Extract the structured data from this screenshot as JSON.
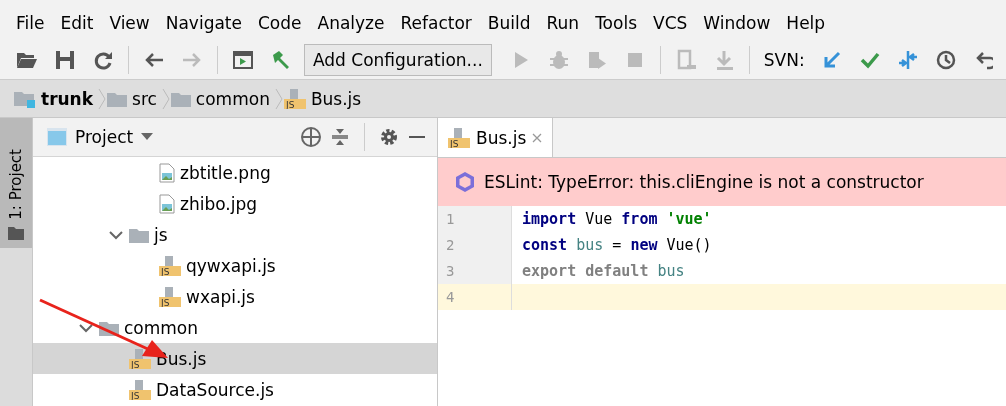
{
  "menu": [
    "File",
    "Edit",
    "View",
    "Navigate",
    "Code",
    "Analyze",
    "Refactor",
    "Build",
    "Run",
    "Tools",
    "VCS",
    "Window",
    "Help"
  ],
  "toolbar": {
    "config_button": "Add Configuration...",
    "svn_label": "SVN:"
  },
  "breadcrumbs": [
    {
      "label": "trunk",
      "kind": "module"
    },
    {
      "label": "src",
      "kind": "folder"
    },
    {
      "label": "common",
      "kind": "folder"
    },
    {
      "label": "Bus.js",
      "kind": "js",
      "icon_label": "JS"
    }
  ],
  "side_tab": {
    "label": "1: Project",
    "selected": true
  },
  "project_panel": {
    "title": "Project",
    "tree": [
      {
        "children": [
          {
            "children": [
              {
                "name": "zbtitle.png",
                "kind": "image",
                "selected": false
              },
              {
                "name": "zhibo.jpg",
                "kind": "image",
                "selected": false
              }
            ]
          },
          {
            "name": "js",
            "kind": "folder",
            "expanded": true,
            "selected": false,
            "children": [
              {
                "name": "qywxapi.js",
                "kind": "js",
                "icon_label": "JS",
                "selected": false
              },
              {
                "name": "wxapi.js",
                "kind": "js",
                "icon_label": "JS",
                "selected": false
              }
            ]
          }
        ]
      },
      {
        "name": "common",
        "kind": "folder",
        "expanded": true,
        "selected": false,
        "children": [
          {
            "name": "Bus.js",
            "kind": "js",
            "icon_label": "JS",
            "selected": true
          },
          {
            "name": "DataSource.js",
            "kind": "js",
            "icon_label": "JS",
            "selected": false
          }
        ]
      }
    ]
  },
  "editor": {
    "tabs": [
      {
        "label": "Bus.js",
        "icon_label": "JS",
        "selected": true
      }
    ],
    "banner": "ESLint: TypeError: this.cliEngine is not a constructor",
    "lines": [
      {
        "number": "1",
        "current": false,
        "tokens": [
          {
            "text": "import",
            "kind": "keyword"
          },
          {
            "text": "Vue",
            "kind": "plain"
          },
          {
            "text": "from",
            "kind": "keyword"
          },
          {
            "text": "'vue'",
            "kind": "string"
          }
        ]
      },
      {
        "number": "2",
        "current": false,
        "tokens": [
          {
            "text": "const",
            "kind": "keyword"
          },
          {
            "text": "bus",
            "kind": "local"
          },
          {
            "text": "=",
            "kind": "plain"
          },
          {
            "text": "new",
            "kind": "keyword"
          },
          {
            "text": "Vue()",
            "kind": "plain"
          }
        ]
      },
      {
        "number": "3",
        "current": false,
        "tokens": [
          {
            "text": "export default",
            "kind": "muted"
          },
          {
            "text": "bus",
            "kind": "local"
          }
        ]
      },
      {
        "number": "4",
        "current": true
      }
    ]
  }
}
